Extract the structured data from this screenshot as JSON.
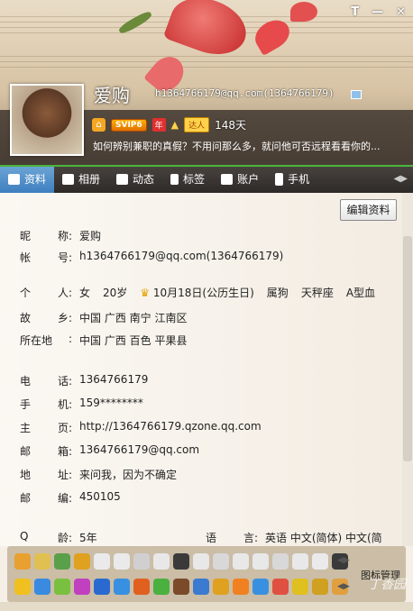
{
  "window": {
    "skin_label": "T",
    "minimize": "—",
    "close": "✕"
  },
  "profile": {
    "nickname": "爱购",
    "account": "h1364766179@qq.com(1364766179)",
    "svip": "SVIP6",
    "year_badge": "年",
    "daren": "达人",
    "days": "148天",
    "signature": "如何辨别兼职的真假？不用问那么多，就问他可否远程看看你的..."
  },
  "tabs": [
    {
      "label": "资料",
      "icon": "profile-card-icon"
    },
    {
      "label": "相册",
      "icon": "photo-icon"
    },
    {
      "label": "动态",
      "icon": "feed-icon"
    },
    {
      "label": "标签",
      "icon": "bookmark-icon"
    },
    {
      "label": "账户",
      "icon": "wallet-icon"
    },
    {
      "label": "手机",
      "icon": "phone-icon"
    }
  ],
  "edit_button": "编辑资料",
  "fields": {
    "nickname": {
      "l1": "昵",
      "l2": "称:",
      "value": "爱购"
    },
    "account": {
      "l1": "帐",
      "l2": "号:",
      "value": "h1364766179@qq.com(1364766179)"
    },
    "personal": {
      "l1": "个",
      "l2": "人:",
      "gender": "女",
      "age": "20岁",
      "birthday": "10月18日(公历生日)",
      "zodiac": "属狗",
      "constellation": "天秤座",
      "blood": "A型血"
    },
    "hometown": {
      "l1": "故",
      "l2": "乡:",
      "value": "中国 广西 南宁 江南区"
    },
    "location": {
      "l1": "所在地",
      "l2": ":",
      "value": "中国 广西 百色 平果县"
    },
    "phone": {
      "l1": "电",
      "l2": "话:",
      "value": "1364766179"
    },
    "mobile": {
      "l1": "手",
      "l2": "机:",
      "value": "159********"
    },
    "homepage": {
      "l1": "主",
      "l2": "页:",
      "value": "http://1364766179.qzone.qq.com"
    },
    "email": {
      "l1": "邮",
      "l2": "箱:",
      "value": "1364766179@qq.com"
    },
    "address": {
      "l1": "地",
      "l2": "址:",
      "value": "来问我，因为不确定"
    },
    "zip": {
      "l1": "邮",
      "l2": "编:",
      "value": "450105"
    },
    "qage": {
      "l1": "Q",
      "l2": "龄:",
      "value": "5年"
    },
    "language": {
      "l1": "语",
      "l2": "言:",
      "value": "英语  中文(简体)  中文(简"
    }
  },
  "toolbar": {
    "icon_manager": "图标管理",
    "watermark": "丁香园"
  },
  "colors": {
    "tab_active": "#3f7fc0",
    "accent_green": "#4ab53a"
  }
}
